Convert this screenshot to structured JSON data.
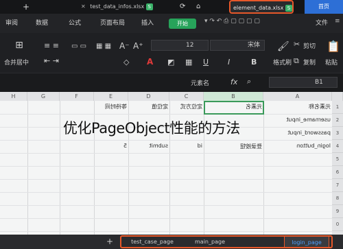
{
  "tabs": {
    "plus": "+",
    "left_title": "test_data_infos.xlsx",
    "active_title": "element_data.xlsx",
    "home": "首页"
  },
  "menubar": {
    "items": [
      "审阅",
      "数据",
      "公式",
      "页面布局",
      "插入"
    ],
    "start": "开始",
    "file": "文件"
  },
  "ribbon": {
    "merge": "合并居中",
    "wrap": "自动换行",
    "font_size": "12",
    "font_name": "宋体",
    "cut": "剪切",
    "paste": "粘贴",
    "format_painter": "格式刷",
    "copy": "复制",
    "bold": "B",
    "italic": "I",
    "underline": "U",
    "font_color": "A",
    "grow_font": "A⁺",
    "shrink_font": "A⁻"
  },
  "formula_bar": {
    "cell_ref": "B1",
    "content": "元素名"
  },
  "columns": [
    "H",
    "G",
    "F",
    "E",
    "D",
    "C",
    "B",
    "A"
  ],
  "rows": [
    "1",
    "2",
    "3",
    "4",
    "5",
    "6",
    "7",
    "8",
    "9",
    "0",
    "1"
  ],
  "cells": {
    "a1": "元素名称",
    "b1": "元素名",
    "c1": "定位方式",
    "d1": "定位值",
    "e1": "等待时间",
    "a2": "username_input",
    "a3": "password_input",
    "a4": "login_button",
    "b4": "登录按钮",
    "c4": "id",
    "d4": "submit",
    "e4": "5"
  },
  "sheet_tabs": {
    "add": "+",
    "items": [
      "test_case_page",
      "main_page",
      "login_page"
    ]
  },
  "overlay_caption": "优化PageObject性能的方法"
}
